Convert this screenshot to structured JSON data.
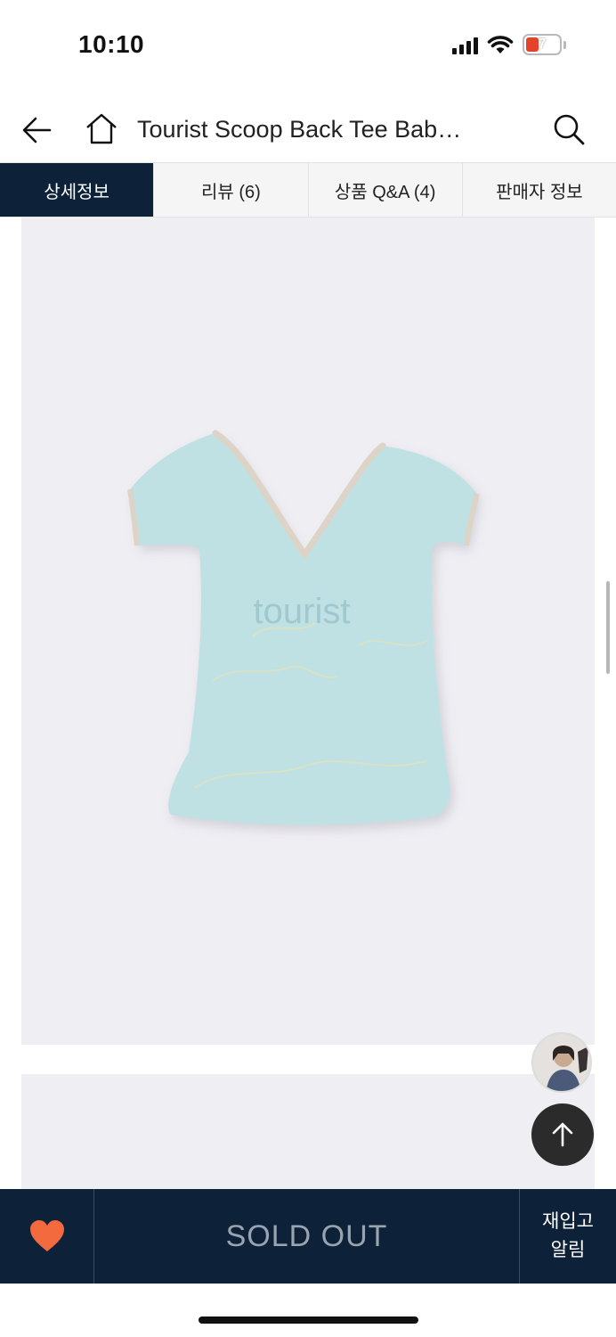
{
  "status_bar": {
    "time": "10:10",
    "battery_level": "7",
    "icons": [
      "signal-icon",
      "wifi-icon",
      "battery-icon"
    ]
  },
  "header": {
    "title": "Tourist Scoop Back Tee Bab…",
    "icons": [
      "back-arrow-icon",
      "home-icon",
      "search-icon"
    ]
  },
  "tabs": [
    {
      "label": "상세정보",
      "active": true
    },
    {
      "label": "리뷰 (6)",
      "active": false
    },
    {
      "label": "상품 Q&A (4)",
      "active": false
    },
    {
      "label": "판매자 정보",
      "active": false
    }
  ],
  "product_image": {
    "printed_text": "tourist"
  },
  "floating": {
    "icons": [
      "avatar",
      "arrow-up-icon"
    ]
  },
  "bottom_bar": {
    "soldout_label": "SOLD OUT",
    "restock_line1": "재입고",
    "restock_line2": "알림",
    "heart_color": "#f26a3e",
    "bar_color": "#0d2238"
  }
}
